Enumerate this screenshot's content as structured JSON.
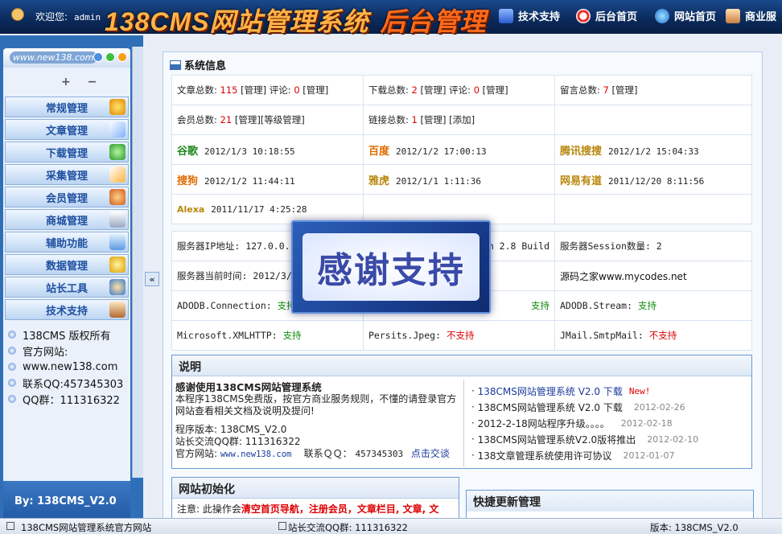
{
  "header": {
    "welcome": "欢迎您:",
    "user": "admin",
    "logo": "138CMS网站管理系统",
    "logo_suffix": "后台管理",
    "nav": [
      {
        "label": "技术支持",
        "icon": "support-icon"
      },
      {
        "label": "后台首页",
        "icon": "lifebuoy-icon"
      },
      {
        "label": "网站首页",
        "icon": "globe-icon"
      },
      {
        "label": "商业服",
        "icon": "person-icon"
      }
    ]
  },
  "sidebar": {
    "url": "www.new138.com",
    "expand_collapse": "+ −",
    "menu": [
      {
        "label": "常规管理",
        "icon": "gear-icon"
      },
      {
        "label": "文章管理",
        "icon": "article-icon"
      },
      {
        "label": "下载管理",
        "icon": "download-icon"
      },
      {
        "label": "采集管理",
        "icon": "collect-icon"
      },
      {
        "label": "会员管理",
        "icon": "members-icon"
      },
      {
        "label": "商城管理",
        "icon": "cart-icon"
      },
      {
        "label": "辅助功能",
        "icon": "tools-icon"
      },
      {
        "label": "数据管理",
        "icon": "data-icon"
      },
      {
        "label": "站长工具",
        "icon": "webmaster-icon"
      },
      {
        "label": "技术支持",
        "icon": "support-icon"
      }
    ],
    "info": [
      "138CMS 版权所有",
      "官方网站:",
      "www.new138.com",
      "联系QQ:457345303",
      "QQ群：111316322"
    ],
    "by": "By: 138CMS_V2.0"
  },
  "sysinfo": {
    "title": "系统信息",
    "stats": [
      [
        "文章总数: ",
        "115",
        " [管理] 评论: ",
        "0",
        " [管理]"
      ],
      [
        "下载总数: ",
        "2",
        " [管理] 评论: ",
        "0",
        " [管理]"
      ],
      [
        "留言总数: ",
        "7",
        " [管理]",
        "",
        ""
      ],
      [
        "会员总数: ",
        "21",
        " [管理][等级管理]",
        "",
        ""
      ],
      [
        "链接总数: ",
        "1",
        " [管理] [添加]",
        "",
        ""
      ]
    ],
    "engines": [
      {
        "name": "谷歌",
        "time": "2012/1/3 10:18:55"
      },
      {
        "name": "百度",
        "time": "2012/1/2 17:00:13"
      },
      {
        "name": "腾讯搜搜",
        "time": "2012/1/2 15:04:33"
      },
      {
        "name": "搜狗",
        "time": "2012/1/2 11:44:11"
      },
      {
        "name": "雅虎",
        "time": "2012/1/1 1:11:36"
      },
      {
        "name": "网易有道",
        "time": "2011/12/20 8:11:56"
      },
      {
        "name": "Alexa",
        "time": "2011/11/17 4:25:28"
      }
    ]
  },
  "server": {
    "ip_label": "服务器IP地址: 127.0.0.1",
    "version_fragment": "on 2.8 Build",
    "session_label": "服务器Session数量: 2",
    "time_label": "服务器当前时间: 2012/3/3",
    "watermark": "源码之家www.mycodes.net",
    "components": [
      {
        "name": "ADODB.Connection:",
        "status": "支持",
        "ok": true
      },
      {
        "name": "",
        "status": "支持",
        "ok": true
      },
      {
        "name": "ADODB.Stream:",
        "status": "支持",
        "ok": true
      },
      {
        "name": "Microsoft.XMLHTTP:",
        "status": "支持",
        "ok": true
      },
      {
        "name": "Persits.Jpeg:",
        "status": "不支持",
        "ok": false
      },
      {
        "name": "JMail.SmtpMail:",
        "status": "不支持",
        "ok": false
      }
    ]
  },
  "banner": {
    "text": "感谢支持"
  },
  "explain": {
    "title": "说明",
    "heading": "感谢使用138CMS网站管理系统",
    "body": "本程序138CMS免费版，按官方商业服务规则，不懂的请登录官方网站查看相关文档及说明及提问!",
    "version": "程序版本: 138CMS_V2.0",
    "qq_group": "站长交流QQ群: 111316322",
    "site_label": "官方网站: ",
    "site_url": "www.new138.com",
    "contact_label": "联系ＱＱ：",
    "contact_qq": "457345303",
    "click_chat": "点击交谈",
    "news": [
      {
        "title": "138CMS网站管理系统 V2.0 下载",
        "date": "",
        "badge": "New!"
      },
      {
        "title": "138CMS网站管理系统 V2.0 下载",
        "date": "2012-02-26",
        "badge": ""
      },
      {
        "title": "2012-2-18网站程序升级。。。。",
        "date": "2012-02-18",
        "badge": ""
      },
      {
        "title": "138CMS网站管理系统V2.0版将推出",
        "date": "2012-02-10",
        "badge": ""
      },
      {
        "title": "138文章管理系统使用许可协议",
        "date": "2012-01-07",
        "badge": ""
      }
    ]
  },
  "init": {
    "title": "网站初始化",
    "note_prefix": "注意: 此操作会",
    "note_bold": "清空首页导航，注册会员，文章栏目, 文章, 文"
  },
  "quick": {
    "title": "快捷更新管理"
  },
  "status": {
    "left": "138CMS网站管理系统官方网站",
    "middle": "站长交流QQ群: 111316322",
    "right": "版本: 138CMS_V2.0"
  }
}
